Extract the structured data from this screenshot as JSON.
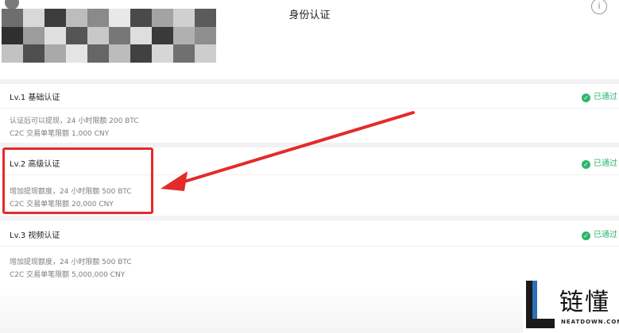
{
  "header": {
    "title": "身份认证",
    "info_icon": "i"
  },
  "levels": [
    {
      "title": "Lv.1 基础认证",
      "status": "已通过",
      "lines": [
        "认证后可以提现，24 小时限额 200 BTC",
        "C2C 交易单笔限额 1,000 CNY"
      ]
    },
    {
      "title": "Lv.2 高级认证",
      "status": "已通过",
      "lines": [
        "增加提现额度，24 小时限额 500 BTC",
        "C2C 交易单笔限额 20,000 CNY"
      ]
    },
    {
      "title": "Lv.3 视频认证",
      "status": "已通过",
      "lines": [
        "增加提现额度，24 小时限额 500 BTC",
        "C2C 交易单笔限额 5,000,000 CNY"
      ]
    }
  ],
  "watermark": {
    "brand": "链懂",
    "site": "NEATDOWN.COM"
  },
  "colors": {
    "status_green": "#2db56e",
    "annotation_red": "#e32b2b",
    "separator": "#f2f2f2"
  },
  "icons": {
    "status": "check-circle-icon",
    "info": "info-icon",
    "back": "back-icon"
  }
}
